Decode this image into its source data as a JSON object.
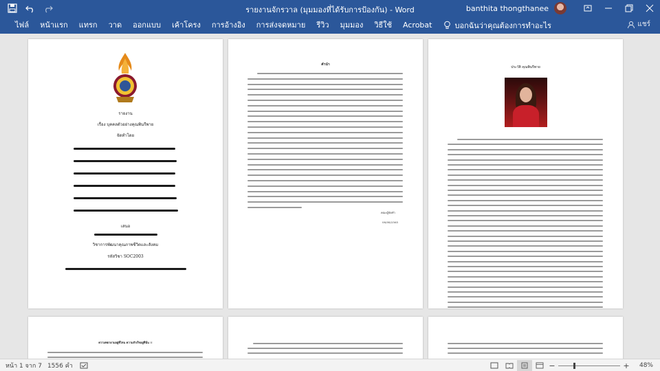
{
  "window": {
    "title": "รายงานจักรวาล (มุมมองที่ได้รับการป้องกัน) - Word",
    "user_name": "banthita thongthanee"
  },
  "ribbon": {
    "tabs": [
      "ไฟล์",
      "หน้าแรก",
      "แทรก",
      "วาด",
      "ออกแบบ",
      "เค้าโครง",
      "การอ้างอิง",
      "การส่งจดหมาย",
      "รีวิว",
      "มุมมอง",
      "วิธีใช้",
      "Acrobat"
    ],
    "tell_me": "บอกฉันว่าคุณต้องการทำอะไร",
    "share": "แชร์"
  },
  "pages": {
    "cover": {
      "report": "รายงาน",
      "subject": "เรื่อง บุคคลตัวอย่างคุณพินรีพาย",
      "prepared_by": "จัดทำโดย",
      "present": "เสนอ",
      "course": "วิชาการพัฒนาคุณภาพชีวิตและสังคม",
      "code": "รหัสวิชา SOC2003"
    },
    "preface": {
      "heading": "คำนำ",
      "signature": "คณะผู้จัดทำ",
      "date": "08/08/2565"
    },
    "history": {
      "heading": "ประวัติ คุณพินรีพาย"
    },
    "story": {
      "heading": "ความพยายามอยู่ที่ไหน ความสำเร็จอยู่ที่นั่น !!"
    }
  },
  "status": {
    "page": "หน้า 1 จาก 7",
    "words": "1556 คำ",
    "zoom": "48%",
    "zoom_level": 0.48
  },
  "colors": {
    "brand": "#2b579a",
    "canvas": "#e6e6e6",
    "statusbar": "#f3f3f3"
  },
  "icons": [
    "word-save-icon",
    "undo-icon",
    "redo-icon",
    "lightbulb-icon",
    "share-user-icon",
    "minimize-icon",
    "restore-icon",
    "close-icon",
    "proofing-icon",
    "read-mode-icon",
    "print-layout-icon",
    "web-layout-icon"
  ]
}
